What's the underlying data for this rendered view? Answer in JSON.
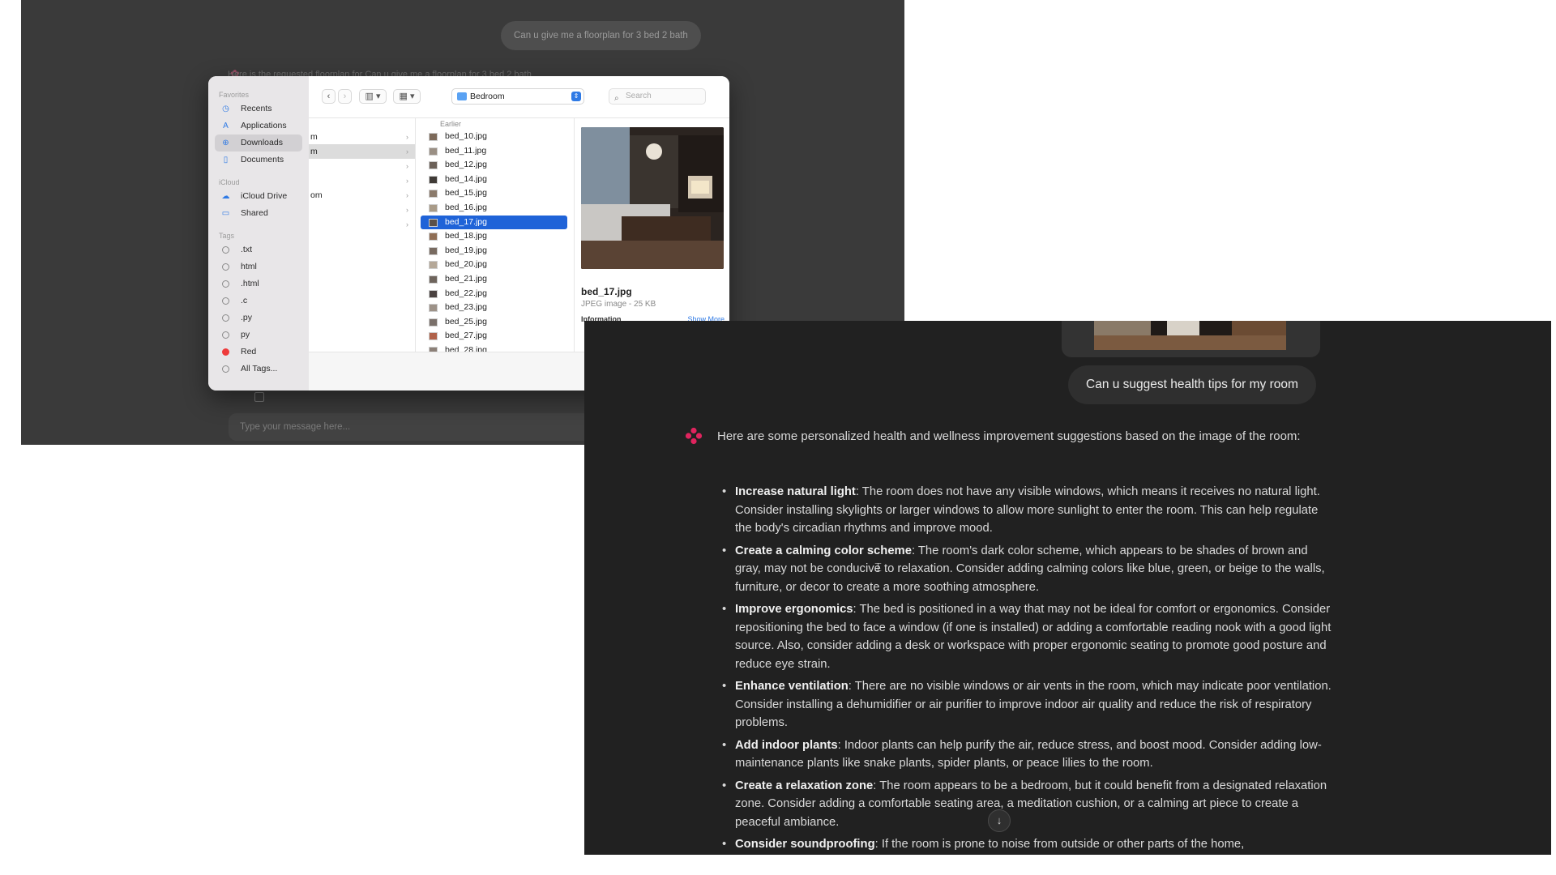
{
  "background_app": {
    "user_message": "Can u give me a floorplan for 3 bed 2 bath",
    "ai_partial_line": "Here is the requested floorplan for Can u give me a floorplan for 3 bed 2 bath",
    "input_placeholder": "Type your message here..."
  },
  "finder": {
    "sidebar": {
      "favorites_header": "Favorites",
      "favorites": [
        {
          "label": "Recents",
          "icon": "clock-icon"
        },
        {
          "label": "Applications",
          "icon": "applications-icon"
        },
        {
          "label": "Downloads",
          "icon": "download-icon",
          "selected": true
        },
        {
          "label": "Documents",
          "icon": "document-icon"
        }
      ],
      "icloud_header": "iCloud",
      "icloud": [
        {
          "label": "iCloud Drive",
          "icon": "cloud-icon"
        },
        {
          "label": "Shared",
          "icon": "shared-folder-icon"
        }
      ],
      "tags_header": "Tags",
      "tags": [
        {
          "label": ".txt"
        },
        {
          "label": "html"
        },
        {
          "label": ".html"
        },
        {
          "label": ".c"
        },
        {
          "label": ".py"
        },
        {
          "label": "py"
        },
        {
          "label": "Red",
          "color": "#ee3b3b"
        },
        {
          "label": "All Tags..."
        }
      ]
    },
    "toolbar": {
      "path_folder": "Bedroom",
      "search_placeholder": "Search"
    },
    "column1": [
      {
        "label": "m",
        "chevron": true
      },
      {
        "label": "m",
        "chevron": true,
        "selected": true
      },
      {
        "label": "",
        "chevron": true
      },
      {
        "label": "",
        "chevron": true
      },
      {
        "label": "om",
        "chevron": true
      },
      {
        "label": "",
        "chevron": true
      },
      {
        "label": "",
        "chevron": true
      }
    ],
    "column2": {
      "header": "Earlier",
      "files": [
        "bed_10.jpg",
        "bed_11.jpg",
        "bed_12.jpg",
        "bed_14.jpg",
        "bed_15.jpg",
        "bed_16.jpg",
        "bed_17.jpg",
        "bed_18.jpg",
        "bed_19.jpg",
        "bed_20.jpg",
        "bed_21.jpg",
        "bed_22.jpg",
        "bed_23.jpg",
        "bed_25.jpg",
        "bed_27.jpg",
        "bed_28.jpg"
      ],
      "selected": "bed_17.jpg"
    },
    "preview": {
      "name": "bed_17.jpg",
      "kind": "JPEG image - 25 KB",
      "info_label": "Information",
      "show_more": "Show More"
    }
  },
  "chat": {
    "user_message": "Can u suggest health tips for my room",
    "ai_intro": "Here are some personalized health and wellness improvement suggestions based on the image of the room:",
    "tips": [
      {
        "title": "Increase natural light",
        "text": ": The room does not have any visible windows, which means it receives no natural light. Consider installing skylights or larger windows to allow more sunlight to enter the room. This can help regulate the body's circadian rhythms and improve mood."
      },
      {
        "title": "Create a calming color scheme",
        "text": ": The room's dark color scheme, which appears to be shades of brown and gray, may not be conducive to relaxation. Consider adding calming colors like blue, green, or beige to the walls, furniture, or decor to create a more soothing atmosphere."
      },
      {
        "title": "Improve ergonomics",
        "text": ": The bed is positioned in a way that may not be ideal for comfort or ergonomics. Consider repositioning the bed to face a window (if one is installed) or adding a comfortable reading nook with a good light source. Also, consider adding a desk or workspace with proper ergonomic seating to promote good posture and reduce eye strain."
      },
      {
        "title": "Enhance ventilation",
        "text": ": There are no visible windows or air vents in the room, which may indicate poor ventilation. Consider installing a dehumidifier or air purifier to improve indoor air quality and reduce the risk of respiratory problems."
      },
      {
        "title": "Add indoor plants",
        "text": ": Indoor plants can help purify the air, reduce stress, and boost mood. Consider adding low-maintenance plants like snake plants, spider plants, or peace lilies to the room."
      },
      {
        "title": "Create a relaxation zone",
        "text": ": The room appears to be a bedroom, but it could benefit from a designated relaxation zone. Consider adding a comfortable seating area, a meditation cushion, or a calming art piece to create a peaceful ambiance."
      },
      {
        "title": "Consider soundproofing",
        "text": ": If the room is prone to noise from outside or other parts of the home,"
      }
    ],
    "scroll_icon": "arrow-down-icon"
  }
}
